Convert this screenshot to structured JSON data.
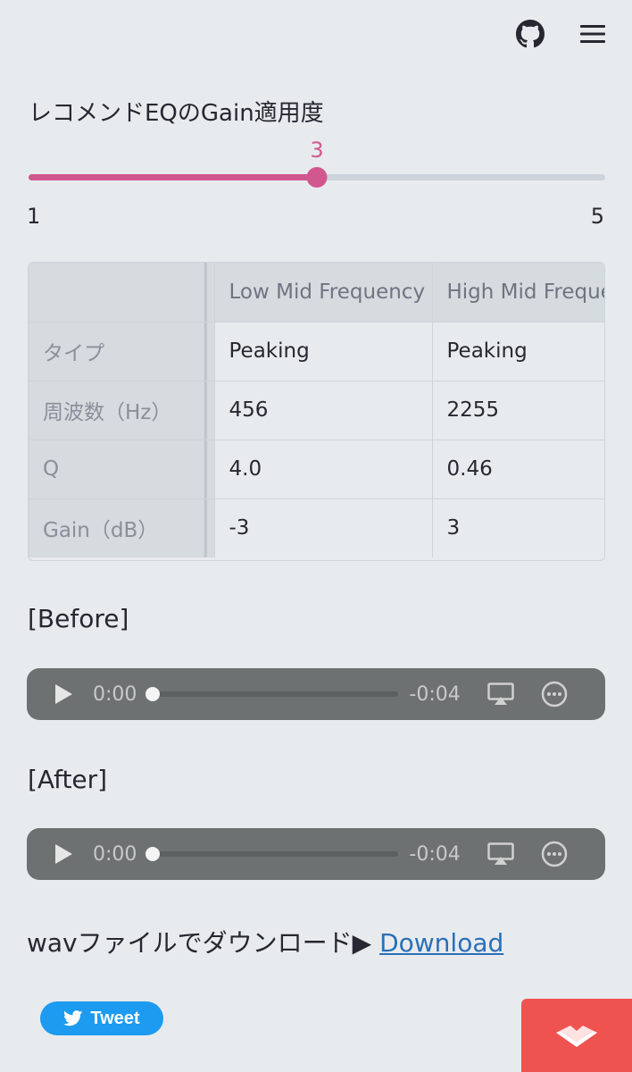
{
  "header": {
    "icons": [
      "github-icon",
      "hamburger-menu-icon"
    ]
  },
  "slider": {
    "label": "レコメンドEQのGain適用度",
    "value": "3",
    "min": "1",
    "max": "5",
    "fraction": 0.5,
    "accent": "#d1578f"
  },
  "table": {
    "columns": [
      "",
      "Low Mid Frequency",
      "High Mid Frequency"
    ],
    "rows": [
      {
        "label": "タイプ",
        "cells": [
          "Peaking",
          "Peaking"
        ]
      },
      {
        "label": "周波数（Hz）",
        "cells": [
          "456",
          "2255"
        ]
      },
      {
        "label": "Q",
        "cells": [
          "4.0",
          "0.46"
        ]
      },
      {
        "label": "Gain（dB）",
        "cells": [
          "-3",
          "3"
        ]
      }
    ]
  },
  "before": {
    "label": "[Before]",
    "current": "0:00",
    "remaining": "-0:04"
  },
  "after": {
    "label": "[After]",
    "current": "0:00",
    "remaining": "-0:04"
  },
  "download": {
    "text": "wavファイルでダウンロード▶ ",
    "link": "Download"
  },
  "tweet": {
    "label": "Tweet",
    "color": "#1d9bf0"
  },
  "streamlit_badge": {
    "color": "#ef5350"
  }
}
